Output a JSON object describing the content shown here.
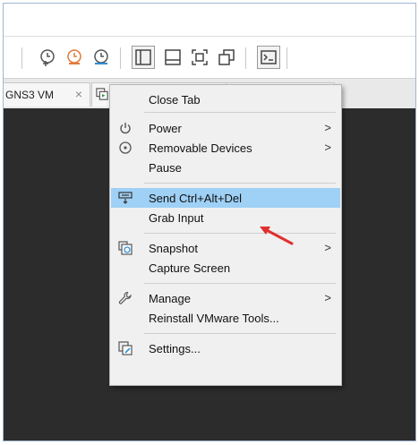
{
  "tabs": [
    {
      "label": "GNS3 VM"
    }
  ],
  "context_menu": {
    "items": [
      {
        "label": "Close Tab",
        "icon": "none",
        "submenu": false
      },
      {
        "label": "Power",
        "icon": "power-icon",
        "submenu": true
      },
      {
        "label": "Removable Devices",
        "icon": "disc-icon",
        "submenu": true
      },
      {
        "label": "Pause",
        "icon": "none",
        "submenu": false
      },
      {
        "label": "Send Ctrl+Alt+Del",
        "icon": "keyboard-send-icon",
        "submenu": false,
        "highlighted": true
      },
      {
        "label": "Grab Input",
        "icon": "none",
        "submenu": false
      },
      {
        "label": "Snapshot",
        "icon": "snapshot-icon",
        "submenu": true
      },
      {
        "label": "Capture Screen",
        "icon": "none",
        "submenu": false
      },
      {
        "label": "Manage",
        "icon": "wrench-icon",
        "submenu": true
      },
      {
        "label": "Reinstall VMware Tools...",
        "icon": "none",
        "submenu": false
      },
      {
        "label": "Settings...",
        "icon": "settings-icon",
        "submenu": false
      }
    ],
    "submenu_arrow": ">",
    "highlight_color": "#9fd0f5"
  },
  "colors": {
    "vm_background": "#2c2c2c",
    "menu_background": "#f0f0f0",
    "annotation_arrow": "#e03030"
  }
}
